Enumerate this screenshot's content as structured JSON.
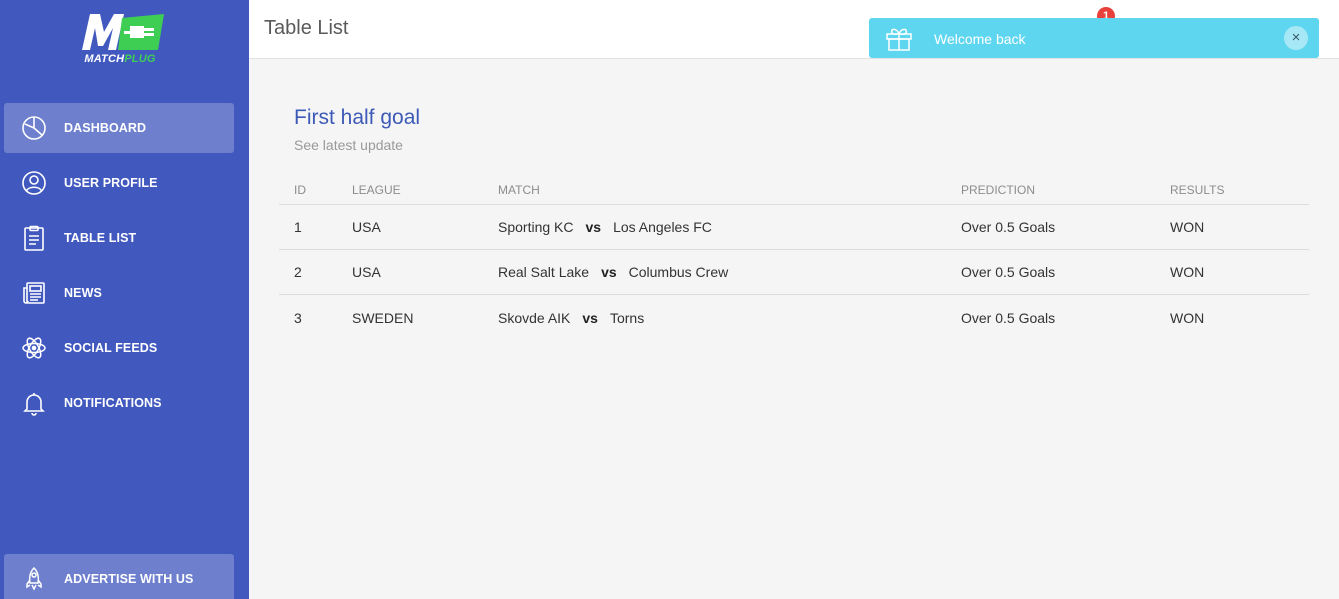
{
  "brand": {
    "logo_word_a": "MATCH",
    "logo_word_b": "PLUG",
    "accent": "#3fce54"
  },
  "sidebar": {
    "bg": "#4159bf",
    "items": [
      {
        "label": "DASHBOARD",
        "icon": "pie-chart-icon",
        "active": true
      },
      {
        "label": "USER PROFILE",
        "icon": "user-circle-icon"
      },
      {
        "label": "TABLE LIST",
        "icon": "clipboard-icon"
      },
      {
        "label": "NEWS",
        "icon": "newspaper-icon"
      },
      {
        "label": "SOCIAL FEEDS",
        "icon": "atom-icon"
      },
      {
        "label": "NOTIFICATIONS",
        "icon": "bell-icon"
      }
    ],
    "bottom": {
      "label": "ADVERTISE WITH US",
      "icon": "rocket-icon"
    }
  },
  "header": {
    "title": "Table List",
    "badge_count": "1"
  },
  "toast": {
    "message": "Welcome back",
    "close": "×",
    "icon": "gift-icon",
    "bg": "#5fd6ef"
  },
  "card": {
    "title": "First half goal",
    "subtitle": "See latest update"
  },
  "table": {
    "columns": [
      "ID",
      "LEAGUE",
      "MATCH",
      "PREDICTION",
      "RESULTS"
    ],
    "rows": [
      {
        "id": "1",
        "league": "USA",
        "home": "Sporting KC",
        "vs": "vs",
        "away": "Los Angeles FC",
        "prediction": "Over 0.5 Goals",
        "result": "WON"
      },
      {
        "id": "2",
        "league": "USA",
        "home": "Real Salt Lake",
        "vs": "vs",
        "away": "Columbus Crew",
        "prediction": "Over 0.5 Goals",
        "result": "WON"
      },
      {
        "id": "3",
        "league": "SWEDEN",
        "home": "Skovde AIK",
        "vs": "vs",
        "away": "Torns",
        "prediction": "Over 0.5 Goals",
        "result": "WON"
      }
    ]
  }
}
